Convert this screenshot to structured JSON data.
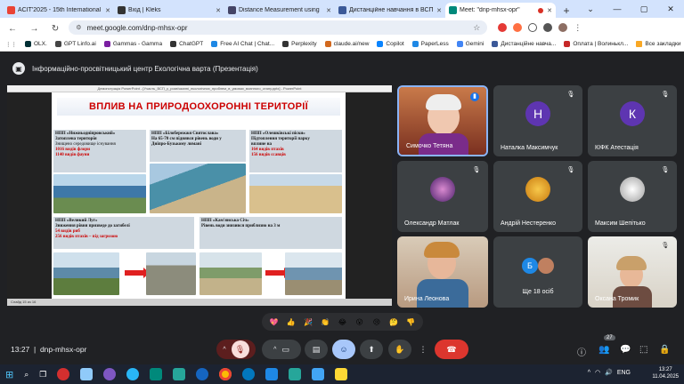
{
  "browser": {
    "tabs": [
      {
        "label": "ACIT'2025 - 15th International",
        "color": "#ea4335"
      },
      {
        "label": "Вхід | Kleks",
        "color": "#333333"
      },
      {
        "label": "Distance Measurement using",
        "color": "#444466"
      },
      {
        "label": "Дистанційне навчання в ВСП",
        "color": "#3b5998"
      },
      {
        "label": "Meet: \"dnp-mhsx-opr\"",
        "color": "#00897b",
        "active": true
      }
    ],
    "new_tab": "+",
    "url": "meet.google.com/dnp-mhsx-opr",
    "bookmarks": [
      "OLX.",
      "GPT Linfo.ai",
      "Gammas - Gamma",
      "ChatGPT",
      "Free AI Chat | Chat...",
      "Perplexity",
      "claude.ai/new",
      "Copilot",
      "PaperLess",
      "Gemini",
      "Дистанційне навча...",
      "Оплата | Волинькл..."
    ],
    "all_bookmarks": "Все закладки"
  },
  "meet": {
    "presenter_title": "Інформаційно-просвітницький центр Екологічна варта (Презентація)",
    "time": "13:27",
    "meeting_code": "dnp-mhsx-opr",
    "participants_count": "27",
    "participants": [
      {
        "name": "Симочко Тетяна",
        "initial": "",
        "color": "#8a3b2a"
      },
      {
        "name": "Наталка Максимчук",
        "initial": "Н",
        "color": "#5e35b1"
      },
      {
        "name": "КІФК Атестація",
        "initial": "К",
        "color": "#5e35b1"
      },
      {
        "name": "Олександр Матлак",
        "initial": "",
        "color": "#6a3fa0"
      },
      {
        "name": "Андрій Нестеренко",
        "initial": "",
        "color": "#e0a020"
      },
      {
        "name": "Максим Шепітько",
        "initial": "",
        "color": "#e0e0e0"
      },
      {
        "name": "Ирина Леонова",
        "initial": "",
        "color": "#c9a27e"
      },
      {
        "name": "Ще 18 осіб",
        "initial": "Б",
        "color": "#1e88e5"
      },
      {
        "name": "Оксана Тромик",
        "initial": "",
        "color": "#d8c3a5"
      }
    ],
    "reactions": [
      "💖",
      "👍",
      "🎉",
      "👏",
      "😂",
      "😮",
      "😢",
      "🤔",
      "👎"
    ]
  },
  "presentation": {
    "window_title": "Демонстрація PowerPoint - [Участь_ВСП_у_розв'язанні_екологічних_проблем_в_умовах_воєнного_стану.pptx] - PowerPoint",
    "slide_title": "ВПЛИВ НА ПРИРОДООХОРОННІ ТЕРИТОРІЇ",
    "boxes": [
      {
        "title": "НПП «Нижньодніпровський»",
        "lines": [
          "Затоплена територія",
          "Знищено середовище існування"
        ],
        "red": [
          "1016 видів флори",
          "1140 видів фауни"
        ]
      },
      {
        "title": "НПП «Білобережжя Святослава»",
        "lines": [
          "На 65-70 см піднявся рівень води у",
          "Дніпро-Бузькому лимані"
        ],
        "red": []
      },
      {
        "title": "НПП «Олешківські піски»",
        "lines": [
          "Підтоплення території парку",
          "вплине на"
        ],
        "red": [
          "164 видів птахів",
          "156 видів ссавців"
        ]
      },
      {
        "title": "НПП «Великий Луг»",
        "lines": [
          "Зниження рівня призведе до загибелі"
        ],
        "red": [
          "54 видів риб",
          "256 видів птахів – під загрозою"
        ]
      },
      {
        "title": "НПП «Кам'янська Січ»",
        "lines": [
          "Рівень води знизився приблизно на 3 м"
        ],
        "red": []
      }
    ],
    "status": "Слайд 15 из 16"
  },
  "taskbar": {
    "time": "13:27",
    "date": "11.04.2025",
    "lang": "ENG"
  }
}
